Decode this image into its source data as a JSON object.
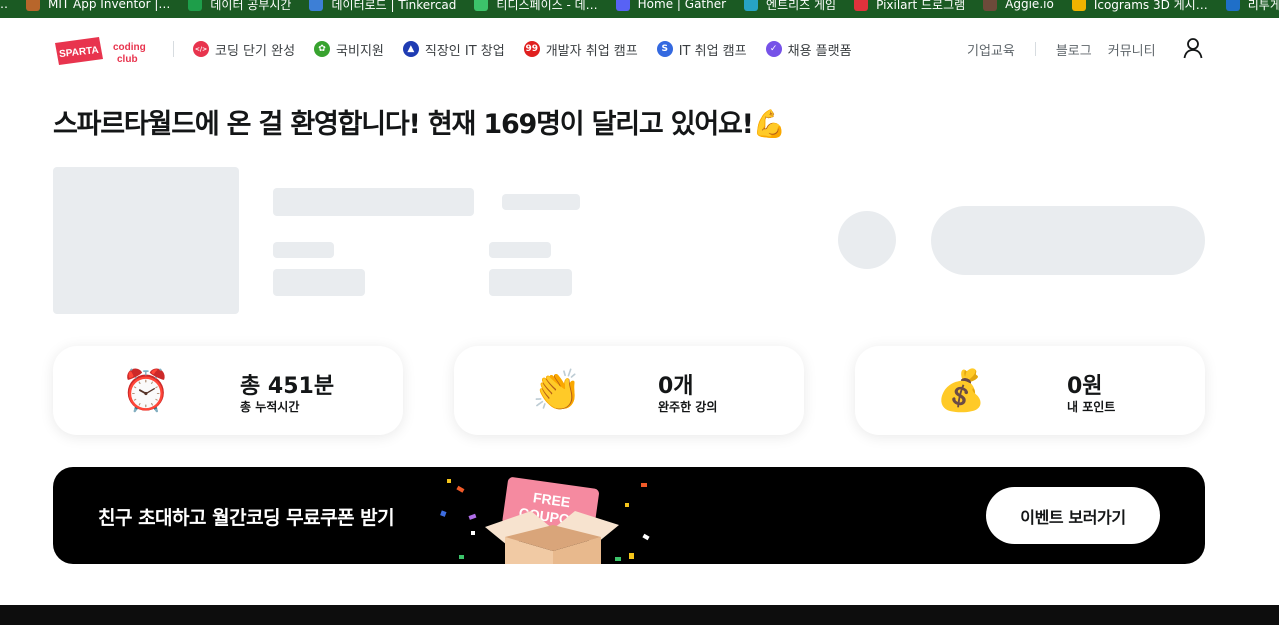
{
  "bookmarks": [
    {
      "label": "…",
      "icon": "bookmark-icon",
      "color": "#1b5a23"
    },
    {
      "label": "MIT App Inventor |…",
      "icon": "app-inventor-icon",
      "color": "#b8662b"
    },
    {
      "label": "데이터 공부시간",
      "icon": "sheet-icon",
      "color": "#1e9e4a"
    },
    {
      "label": "데이터로드 | Tinkercad",
      "icon": "tinkercad-icon",
      "color": "#3d7fd6"
    },
    {
      "label": "티디스페이스 - 데…",
      "icon": "space-icon",
      "color": "#3cc36a"
    },
    {
      "label": "Home | Gather",
      "icon": "gather-icon",
      "color": "#5862f5"
    },
    {
      "label": "엔트리즈 게임",
      "icon": "entry-icon",
      "color": "#27a3c6"
    },
    {
      "label": "Pixilart 드로그램",
      "icon": "pixilart-icon",
      "color": "#e0323c"
    },
    {
      "label": "Aggie.io",
      "icon": "aggie-icon",
      "color": "#6c4a3a"
    },
    {
      "label": "Icograms 3D 게시…",
      "icon": "icograms-icon",
      "color": "#f0b400"
    },
    {
      "label": "리투게임",
      "icon": "link-icon",
      "color": "#1f6fc8"
    }
  ],
  "nav": {
    "logo": {
      "line1": "SPARTA",
      "line2": "coding",
      "line3": "club"
    },
    "items": [
      {
        "label": "코딩 단기 완성",
        "icon": "code-icon",
        "color": "#e8344e"
      },
      {
        "label": "국비지원",
        "icon": "sprout-icon",
        "color": "#38a32f"
      },
      {
        "label": "직장인 IT 창업",
        "icon": "rocket-icon",
        "color": "#1f3cb3"
      },
      {
        "label": "개발자 취업 캠프",
        "icon": "ninety-nine-icon",
        "color": "#e0201f"
      },
      {
        "label": "IT 취업 캠프",
        "icon": "s-icon",
        "color": "#3469e0"
      },
      {
        "label": "채용 플랫폼",
        "icon": "check-icon",
        "color": "#7652e8"
      }
    ],
    "right": [
      "기업교육",
      "블로그",
      "커뮤니티"
    ]
  },
  "welcome": "스파르타월드에 온 걸 환영합니다! 현재 169명이 달리고 있어요!💪",
  "stats": [
    {
      "value": "총 451분",
      "label": "총 누적시간",
      "icon": "alarm-clock-icon",
      "emoji": "⏰"
    },
    {
      "value": "0개",
      "label": "완주한 강의",
      "icon": "clapping-hands-icon",
      "emoji": "👏"
    },
    {
      "value": "0원",
      "label": "내 포인트",
      "icon": "money-bag-icon",
      "emoji": "💰"
    }
  ],
  "banner": {
    "text": "친구 초대하고 월간코딩 무료쿠폰 받기",
    "coupon_line1": "FREE",
    "coupon_line2": "COUPON",
    "button": "이벤트 보러가기"
  },
  "colors": {
    "brand": "#e8344e",
    "skeleton": "#e9ecef",
    "banner_bg": "#000000"
  }
}
